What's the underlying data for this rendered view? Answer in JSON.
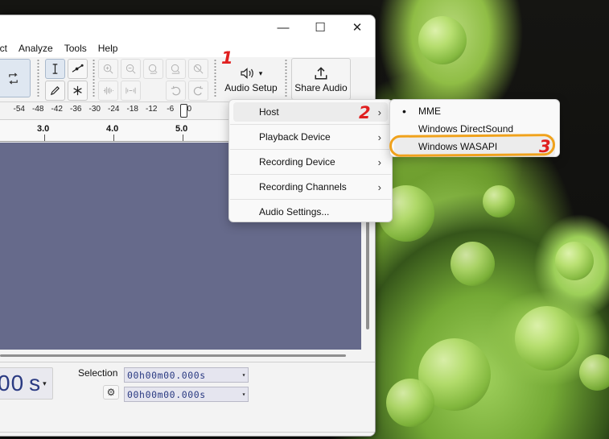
{
  "window": {
    "minimize_glyph": "—",
    "maximize_glyph": "☐",
    "close_glyph": "✕"
  },
  "menubar": [
    "ect",
    "Analyze",
    "Tools",
    "Help"
  ],
  "toolbar": {
    "audio_setup_label": "Audio Setup",
    "audio_setup_icon": "speaker-icon",
    "audio_setup_caret": "▾",
    "share_audio_label": "Share Audio",
    "share_audio_icon": "share-upload-icon"
  },
  "meter": {
    "scale": [
      "-54",
      "-48",
      "-42",
      "-36",
      "-30",
      "-24",
      "-18",
      "-12",
      "-6",
      "0"
    ]
  },
  "ruler": {
    "labels": [
      "3.0",
      "4.0",
      "5.0"
    ]
  },
  "time_display": {
    "value": "00",
    "unit": "s",
    "caret": "▾"
  },
  "selection": {
    "label": "Selection",
    "start": "00h00m00.000s",
    "end": "00h00m00.000s",
    "caret": "▾",
    "gear_icon": "gear-icon"
  },
  "audio_menu": {
    "items": [
      {
        "label": "Host",
        "submenu": true
      },
      {
        "label": "Playback Device",
        "submenu": true
      },
      {
        "label": "Recording Device",
        "submenu": true
      },
      {
        "label": "Recording Channels",
        "submenu": true
      },
      {
        "label": "Audio Settings...",
        "submenu": false
      }
    ],
    "chevron": "›"
  },
  "host_menu": {
    "bullet": "•",
    "items": [
      {
        "label": "MME",
        "checked": true
      },
      {
        "label": "Windows DirectSound",
        "checked": false
      },
      {
        "label": "Windows WASAPI",
        "checked": false
      }
    ]
  },
  "annotations": {
    "step1": "1",
    "step2": "2",
    "step3": "3",
    "number_color": "#e02020",
    "highlight_color": "#f0a21c"
  },
  "colors": {
    "track_background": "#666a8b",
    "time_text": "#2a3a82"
  }
}
